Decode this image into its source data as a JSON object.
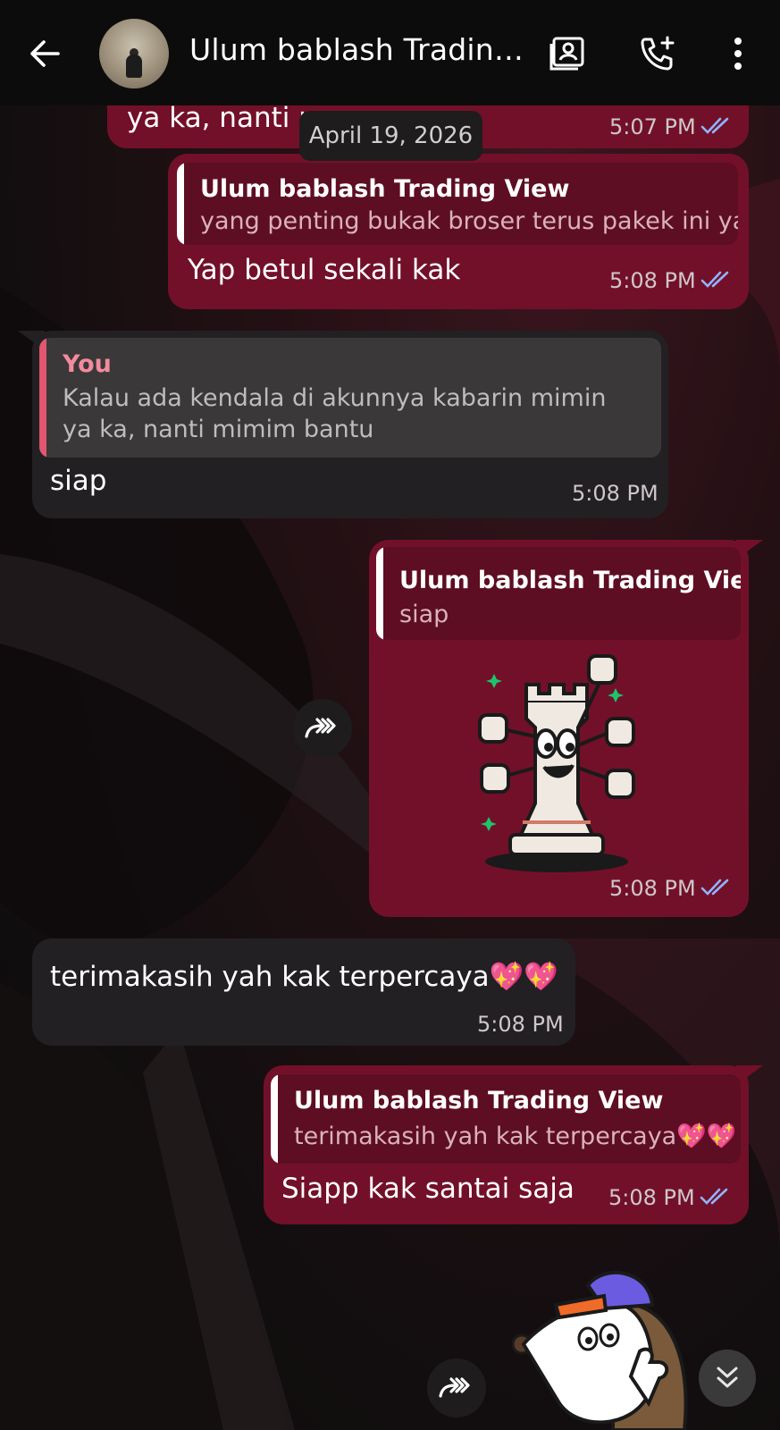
{
  "header": {
    "contact_name": "Ulum bablash Tradin…"
  },
  "date_chip": "April 19, 2026",
  "messages": [
    {
      "type": "outgoing",
      "text": "ya ka, nanti m",
      "time": "5:07 PM"
    },
    {
      "type": "outgoing",
      "quote_name": "Ulum bablash Trading View",
      "quote_text": "yang penting bukak broser terus pakek ini ya",
      "text": "Yap betul sekali kak",
      "time": "5:08 PM"
    },
    {
      "type": "incoming",
      "quote_name": "You",
      "quote_text": "Kalau ada kendala di akunnya kabarin mimin ya ka, nanti mimim bantu",
      "text": "siap",
      "time": "5:08 PM"
    },
    {
      "type": "outgoing",
      "quote_name": "Ulum bablash Trading View",
      "quote_text": "siap",
      "sticker": "chess-rook-thumbs-up-sticker",
      "time": "5:08 PM"
    },
    {
      "type": "incoming",
      "text": "terimakasih yah kak terpercaya💖💖",
      "time": "5:08 PM"
    },
    {
      "type": "outgoing",
      "quote_name": "Ulum bablash Trading View",
      "quote_text": "terimakasih yah kak terpercaya💖💖",
      "text": "Siapp kak santai saja",
      "time": "5:08 PM"
    }
  ],
  "colors": {
    "outgoing_bubble": "#72102a",
    "incoming_bubble": "#222022",
    "read_ticks": "#8fb4ff",
    "quote_bar_out": "#ffffff",
    "quote_bar_in": "#e2566f"
  }
}
